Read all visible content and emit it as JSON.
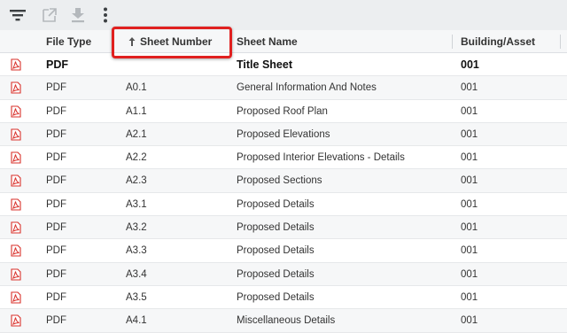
{
  "toolbar": {
    "icons": [
      "filter-icon",
      "export-icon",
      "download-icon",
      "more-options-icon"
    ]
  },
  "table": {
    "columns": {
      "file_type": "File Type",
      "sheet_number": "Sheet Number",
      "sheet_name": "Sheet Name",
      "building": "Building/Asset"
    },
    "sort": {
      "column": "sheet_number",
      "direction": "ascending"
    },
    "highlight_color": "#e0201f",
    "pdf_icon_color": "#d9312b",
    "rows": [
      {
        "file_type": "PDF",
        "sheet_number": "",
        "sheet_name": "Title Sheet",
        "building": "001",
        "bold": true
      },
      {
        "file_type": "PDF",
        "sheet_number": "A0.1",
        "sheet_name": "General Information And Notes",
        "building": "001"
      },
      {
        "file_type": "PDF",
        "sheet_number": "A1.1",
        "sheet_name": "Proposed Roof Plan",
        "building": "001"
      },
      {
        "file_type": "PDF",
        "sheet_number": "A2.1",
        "sheet_name": "Proposed Elevations",
        "building": "001"
      },
      {
        "file_type": "PDF",
        "sheet_number": "A2.2",
        "sheet_name": "Proposed Interior Elevations - Details",
        "building": "001"
      },
      {
        "file_type": "PDF",
        "sheet_number": "A2.3",
        "sheet_name": "Proposed Sections",
        "building": "001"
      },
      {
        "file_type": "PDF",
        "sheet_number": "A3.1",
        "sheet_name": "Proposed Details",
        "building": "001"
      },
      {
        "file_type": "PDF",
        "sheet_number": "A3.2",
        "sheet_name": "Proposed Details",
        "building": "001"
      },
      {
        "file_type": "PDF",
        "sheet_number": "A3.3",
        "sheet_name": "Proposed Details",
        "building": "001"
      },
      {
        "file_type": "PDF",
        "sheet_number": "A3.4",
        "sheet_name": "Proposed Details",
        "building": "001"
      },
      {
        "file_type": "PDF",
        "sheet_number": "A3.5",
        "sheet_name": "Proposed Details",
        "building": "001"
      },
      {
        "file_type": "PDF",
        "sheet_number": "A4.1",
        "sheet_name": "Miscellaneous Details",
        "building": "001"
      }
    ]
  }
}
